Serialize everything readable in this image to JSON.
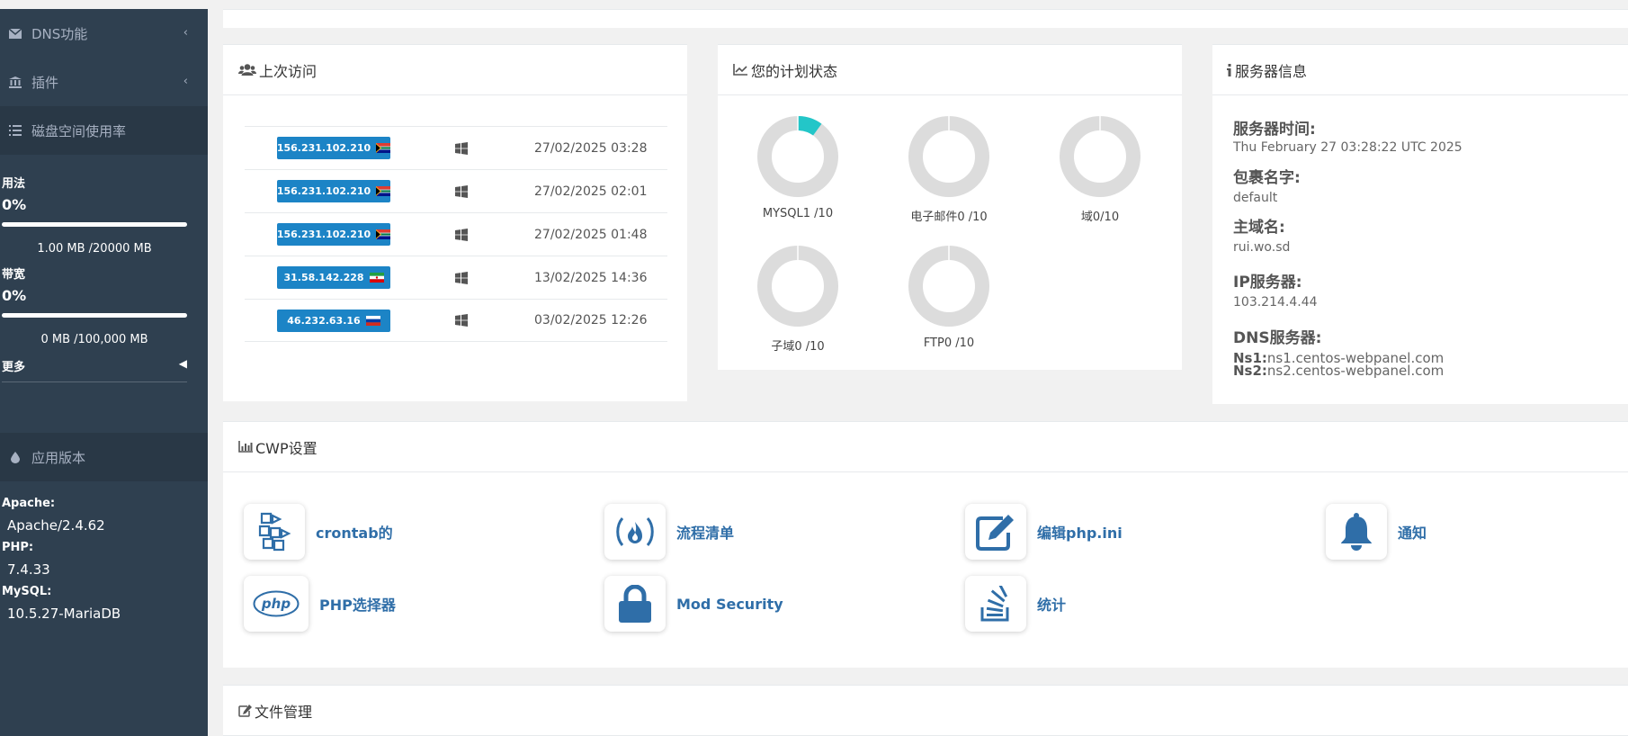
{
  "sidebar": {
    "nav": [
      {
        "label": "DNS功能",
        "icon": "envelope-icon"
      },
      {
        "label": "插件",
        "icon": "bank-icon"
      },
      {
        "label": "磁盘空间使用率",
        "icon": "list-icon"
      }
    ],
    "disk": {
      "label": "用法",
      "percent_text": "0%",
      "percent": 0,
      "usage": "1.00 MB /20000 MB"
    },
    "bandwidth": {
      "label": "带宽",
      "percent_text": "0%",
      "percent": 0,
      "usage": "0 MB /100,000 MB"
    },
    "more_label": "更多",
    "app_version": {
      "label": "应用版本",
      "icon": "tint-icon"
    },
    "versions": [
      {
        "label": "Apache:",
        "value": "Apache/2.4.62"
      },
      {
        "label": "PHP:",
        "value": "7.4.33"
      },
      {
        "label": "MySQL:",
        "value": "10.5.27-MariaDB"
      }
    ]
  },
  "last_visits": {
    "title": "上次访问",
    "rows": [
      {
        "ip": "156.231.102.210",
        "flag": "za",
        "date": "27/02/2025 03:28"
      },
      {
        "ip": "156.231.102.210",
        "flag": "za",
        "date": "27/02/2025 02:01"
      },
      {
        "ip": "156.231.102.210",
        "flag": "za",
        "date": "27/02/2025 01:48"
      },
      {
        "ip": "31.58.142.228",
        "flag": "ir",
        "date": "13/02/2025 14:36"
      },
      {
        "ip": "46.232.63.16",
        "flag": "ru",
        "date": "03/02/2025 12:26"
      }
    ]
  },
  "plan_status": {
    "title": "您的计划状态",
    "items": [
      {
        "label": "MYSQL1 /10",
        "used": 1,
        "max": 10
      },
      {
        "label": "电子邮件0 /10",
        "used": 0,
        "max": 10
      },
      {
        "label": "域0/10",
        "used": 0,
        "max": 10
      },
      {
        "label": "子域0 /10",
        "used": 0,
        "max": 10
      },
      {
        "label": "FTP0 /10",
        "used": 0,
        "max": 10
      }
    ],
    "colors": {
      "used": "#23c6c8",
      "free": "#dcdcdc"
    }
  },
  "server_info": {
    "title": "服务器信息",
    "time_label": "服务器时间:",
    "time_value": "Thu February 27 03:28:22 UTC 2025",
    "package_label": "包裹名字:",
    "package_value": "default",
    "domain_label": "主域名:",
    "domain_value": "rui.wo.sd",
    "ip_label": "IP服务器:",
    "ip_value": "103.214.4.44",
    "dns_label": "DNS服务器:",
    "ns1_label": "Ns1:",
    "ns1_value": "ns1.centos-webpanel.com",
    "ns2_label": "Ns2:",
    "ns2_value": "ns2.centos-webpanel.com"
  },
  "cwp_settings": {
    "title": "CWP设置",
    "tiles": [
      {
        "label": "crontab的",
        "icon": "cubes-icon"
      },
      {
        "label": "流程清单",
        "icon": "free-code-camp-icon"
      },
      {
        "label": "编辑php.ini",
        "icon": "edit-icon"
      },
      {
        "label": "通知",
        "icon": "bell-icon"
      },
      {
        "label": "PHP选择器",
        "icon": "php-icon"
      },
      {
        "label": "Mod Security",
        "icon": "lock-icon"
      },
      {
        "label": "统计",
        "icon": "stack-overflow-icon"
      }
    ]
  },
  "file_manager": {
    "title": "文件管理"
  },
  "accent": "#1c84c6",
  "sidebar_bg": "#2f4050"
}
